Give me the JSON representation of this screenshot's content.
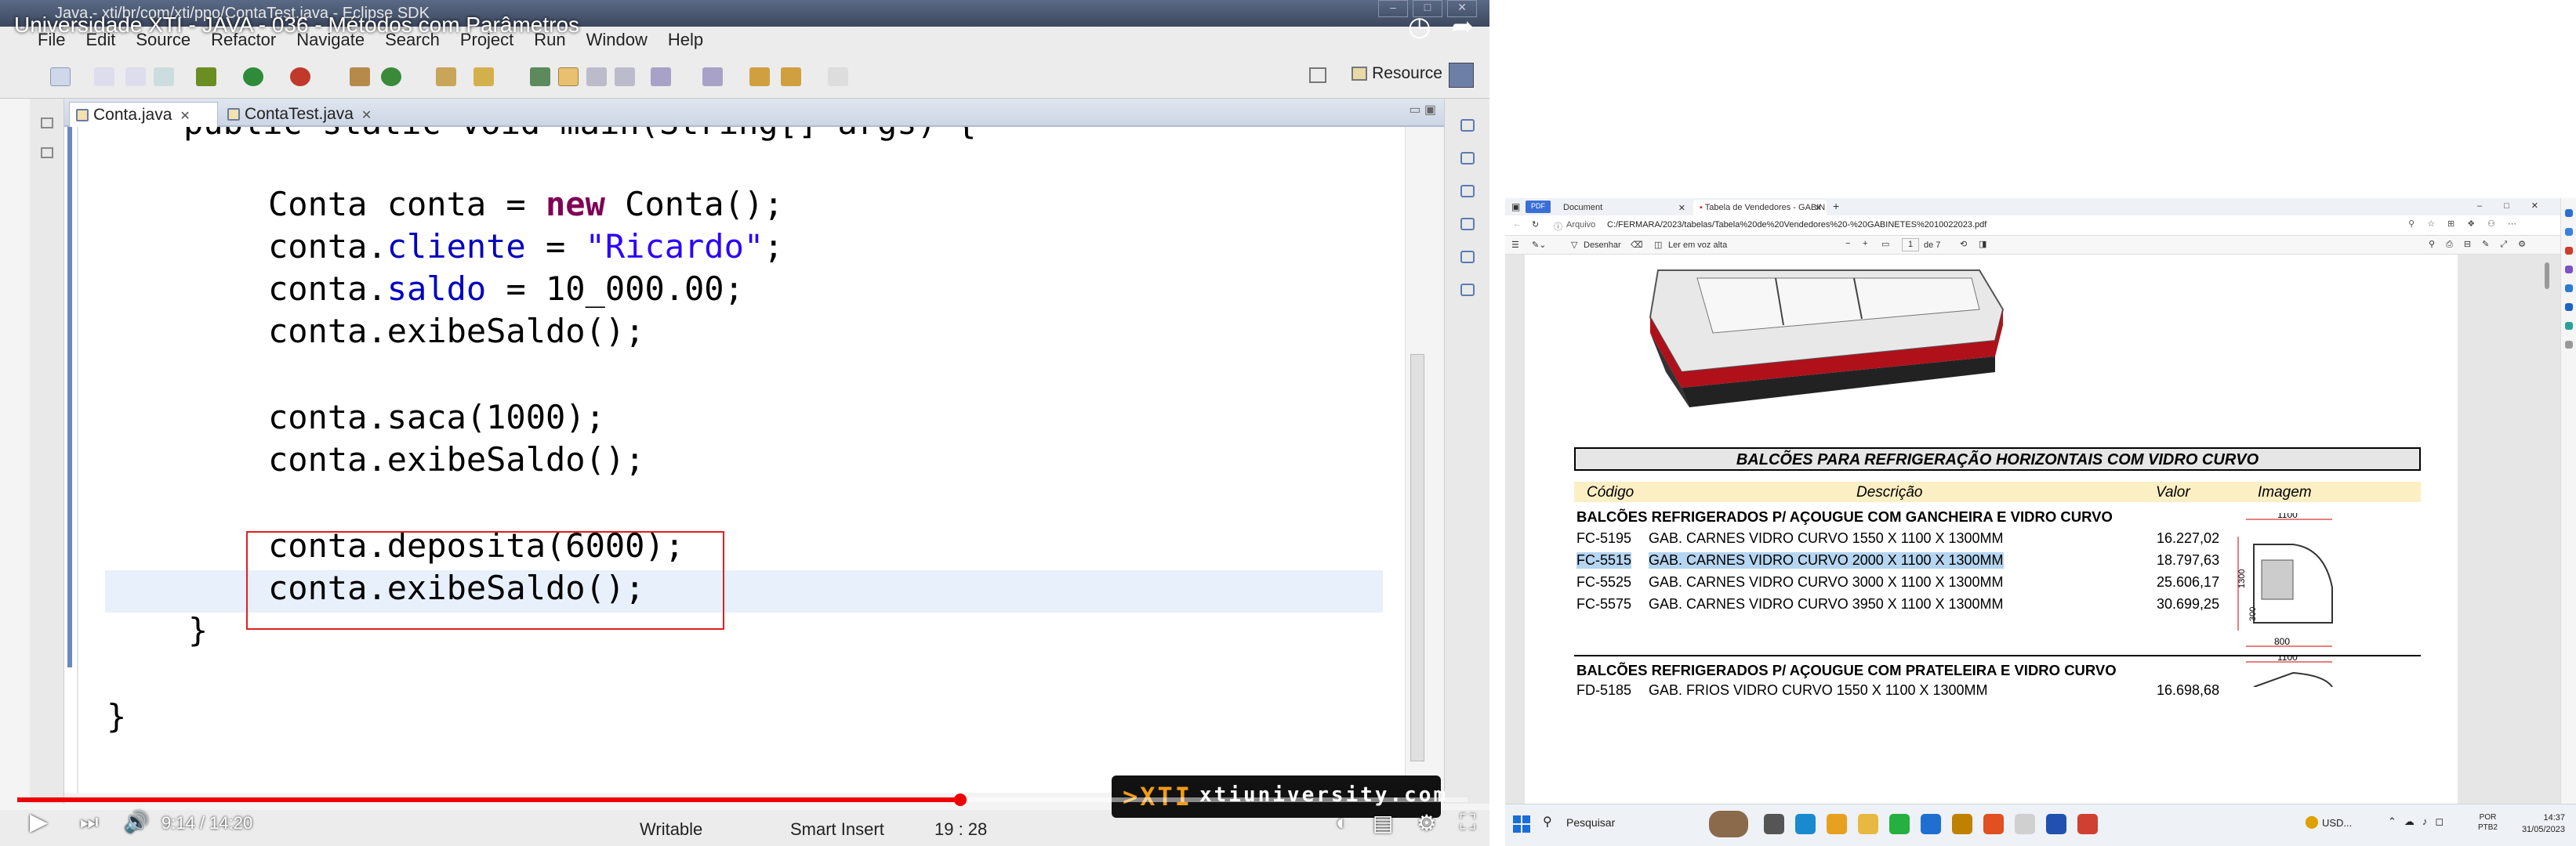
{
  "video": {
    "title": "Universidade XTI - JAVA - 036 - Métodos com Parâmetros",
    "time": "9:14 / 14:20",
    "progress_fraction": 0.65,
    "watermark": "xtiuniversity.com"
  },
  "eclipse": {
    "window_title": "Java - xti/br/com/xti/ppo/ContaTest.java - Eclipse SDK",
    "menu": [
      "File",
      "Edit",
      "Source",
      "Refactor",
      "Navigate",
      "Search",
      "Project",
      "Run",
      "Window",
      "Help"
    ],
    "perspective": "Resource",
    "tabs": [
      {
        "label": "Conta.java"
      },
      {
        "label": "ContaTest.java"
      }
    ],
    "code_partial_top": "public static void main(String[] args) {",
    "code": {
      "l1a": "Conta conta = ",
      "l1kw": "new",
      "l1b": " Conta();",
      "l2a": "conta.",
      "l2f": "cliente",
      "l2b": " = ",
      "l2s": "\"Ricardo\"",
      "l2c": ";",
      "l3a": "conta.",
      "l3f": "saldo",
      "l3b": " = 10_000.00;",
      "l4": "conta.exibeSaldo();",
      "l5": "conta.saca(1000);",
      "l6": "conta.exibeSaldo();",
      "l7": "conta.deposita(6000);",
      "l8": "conta.exibeSaldo();",
      "l9": "}",
      "l10": "}"
    },
    "status": {
      "writable": "Writable",
      "insert_mode": "Smart Insert",
      "position": "19 : 28"
    }
  },
  "browser": {
    "tabs": [
      {
        "label": "Document"
      },
      {
        "label": "Tabela de Vendedores - GABIN"
      }
    ],
    "address_prefix": "Arquivo",
    "address": "C:/FERMARA/2023/tabelas/Tabela%20de%20Vendedores%20-%20GABINETES%2010022023.pdf",
    "pdf_toolbar": {
      "draw": "Desenhar",
      "read_aloud": "Ler em voz alta",
      "page": "1",
      "page_total": "de 7"
    },
    "pdf": {
      "section_title": "BALCÕES PARA REFRIGERAÇÃO  HORIZONTAIS COM VIDRO CURVO",
      "headers": {
        "code": "Código",
        "desc": "Descrição",
        "value": "Valor",
        "image": "Imagem"
      },
      "group1": "BALCÕES REFRIGERADOS P/ AÇOUGUE COM GANCHEIRA E VIDRO CURVO",
      "rows1": [
        {
          "code": "FC-5195",
          "desc": "GAB. CARNES VIDRO CURVO 1550 X 1100 X 1300MM",
          "value": "16.227,02"
        },
        {
          "code": "FC-5515",
          "desc": "GAB. CARNES VIDRO CURVO 2000 X 1100 X 1300MM",
          "value": "18.797,63"
        },
        {
          "code": "FC-5525",
          "desc": "GAB. CARNES VIDRO CURVO 3000 X 1100 X 1300MM",
          "value": "25.606,17"
        },
        {
          "code": "FC-5575",
          "desc": "GAB. CARNES VIDRO CURVO 3950 X 1100 X 1300MM",
          "value": "30.699,25"
        }
      ],
      "group2": "BALCÕES REFRIGERADOS P/ AÇOUGUE COM PRATELEIRA E VIDRO CURVO",
      "rows2": [
        {
          "code": "FD-5185",
          "desc": "GAB. FRIOS VIDRO CURVO 1550 X 1100 X 1300MM",
          "value": "16.698,68"
        }
      ],
      "dim_width": "1100",
      "dim_height": "1300",
      "dim_depth": "800",
      "dim_inner": "300",
      "dim_width2": "1100"
    }
  },
  "taskbar": {
    "search": "Pesquisar",
    "currency": "USD...",
    "lang": "POR",
    "layout": "PTB2",
    "time": "14:37",
    "date": "31/05/2023"
  }
}
